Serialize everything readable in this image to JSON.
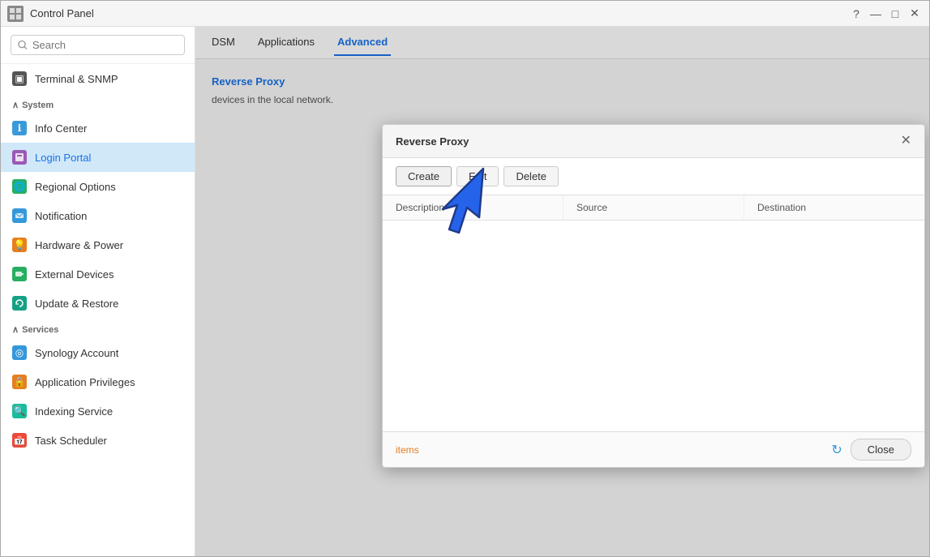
{
  "window": {
    "title": "Control Panel",
    "icon": "control-panel-icon"
  },
  "titlebar": {
    "help_label": "?",
    "minimize_label": "—",
    "maximize_label": "□",
    "close_label": "✕"
  },
  "sidebar": {
    "search_placeholder": "Search",
    "terminal_label": "Terminal & SNMP",
    "sections": [
      {
        "name": "System",
        "items": [
          {
            "id": "info-center",
            "label": "Info Center",
            "icon": "info"
          },
          {
            "id": "login-portal",
            "label": "Login Portal",
            "icon": "login",
            "active": true
          },
          {
            "id": "regional-options",
            "label": "Regional Options",
            "icon": "regional"
          },
          {
            "id": "notification",
            "label": "Notification",
            "icon": "notification"
          },
          {
            "id": "hardware-power",
            "label": "Hardware & Power",
            "icon": "hardware"
          },
          {
            "id": "external-devices",
            "label": "External Devices",
            "icon": "external"
          },
          {
            "id": "update-restore",
            "label": "Update & Restore",
            "icon": "update"
          }
        ]
      },
      {
        "name": "Services",
        "items": [
          {
            "id": "synology-account",
            "label": "Synology Account",
            "icon": "synology"
          },
          {
            "id": "app-privileges",
            "label": "Application Privileges",
            "icon": "apppriv"
          },
          {
            "id": "indexing-service",
            "label": "Indexing Service",
            "icon": "indexing"
          },
          {
            "id": "task-scheduler",
            "label": "Task Scheduler",
            "icon": "tasksch"
          }
        ]
      }
    ]
  },
  "tabs": {
    "items": [
      {
        "id": "dsm",
        "label": "DSM"
      },
      {
        "id": "applications",
        "label": "Applications"
      },
      {
        "id": "advanced",
        "label": "Advanced",
        "active": true
      }
    ]
  },
  "content": {
    "section_title": "Reverse Proxy",
    "description": "devices in the local network."
  },
  "modal": {
    "title": "Reverse Proxy",
    "create_label": "Create",
    "edit_label": "Edit",
    "delete_label": "Delete",
    "close_label": "Close",
    "table_headers": [
      {
        "id": "description",
        "label": "Description"
      },
      {
        "id": "source",
        "label": "Source"
      },
      {
        "id": "destination",
        "label": "Destination"
      }
    ],
    "items_label": "items",
    "refresh_icon": "↻"
  }
}
